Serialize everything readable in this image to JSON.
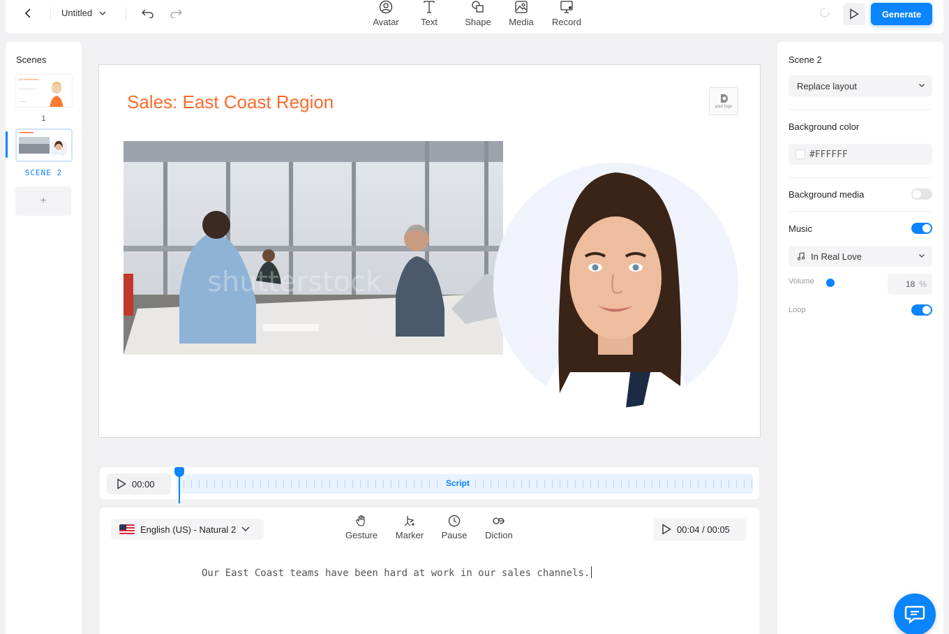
{
  "topbar": {
    "title": "Untitled",
    "tools": [
      {
        "label": "Avatar",
        "icon": "avatar-icon"
      },
      {
        "label": "Text",
        "icon": "text-icon"
      },
      {
        "label": "Shape",
        "icon": "shape-icon"
      },
      {
        "label": "Media",
        "icon": "media-icon"
      },
      {
        "label": "Record",
        "icon": "record-icon"
      }
    ],
    "generate_label": "Generate",
    "accent": "#0a84ff"
  },
  "scenes": {
    "title": "Scenes",
    "items": [
      {
        "number": "1"
      },
      {
        "label": "SCENE 2"
      }
    ],
    "add_label": "+",
    "thumb1_title": "Q3 Presentation"
  },
  "slide": {
    "title": "Sales: East Coast Region",
    "title_color": "#ff6a2b",
    "logo_text": "your logo",
    "watermark": "shutterstock"
  },
  "timeline": {
    "time": "00:00",
    "track_label": "Script"
  },
  "editor": {
    "language": "English (US) - Natural 2",
    "tools": [
      {
        "label": "Gesture",
        "icon": "gesture-icon"
      },
      {
        "label": "Marker",
        "icon": "marker-icon"
      },
      {
        "label": "Pause",
        "icon": "clock-icon"
      },
      {
        "label": "Diction",
        "icon": "diction-icon"
      }
    ],
    "time": "00:04 / 00:05",
    "script": "Our East Coast teams have been hard at work in our sales channels."
  },
  "properties": {
    "title": "Scene 2",
    "layout_select": "Replace layout",
    "background_color_label": "Background color",
    "background_color_value": "#FFFFFF",
    "background_media_label": "Background media",
    "background_media_on": false,
    "music_label": "Music",
    "music_on": true,
    "music_track": "In Real Love",
    "volume_label": "Volume",
    "volume_value": "18",
    "volume_unit": "%",
    "loop_label": "Loop",
    "loop_on": true
  }
}
